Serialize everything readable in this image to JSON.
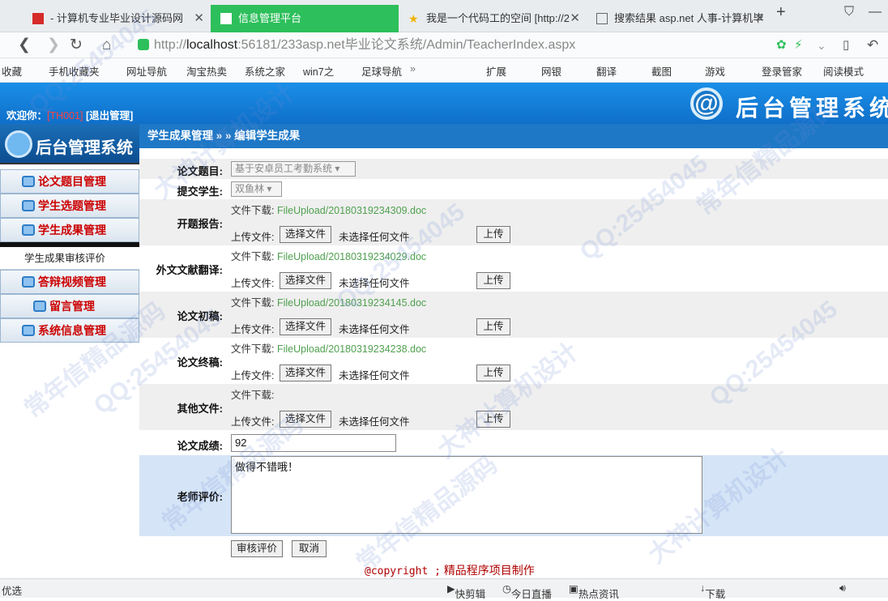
{
  "browser": {
    "tabs": [
      {
        "title": "- 计算机专业毕业设计源码网",
        "active": false
      },
      {
        "title": "信息管理平台",
        "active": true
      },
      {
        "title": "我是一个代码工的空间 [http://2",
        "active": false
      },
      {
        "title": "搜索结果 asp.net 人事-计算机毕",
        "active": false
      }
    ],
    "new_tab": "+",
    "url_prefix": "http://",
    "url_host": "localhost",
    "url_rest": ":56181/233asp.net毕业论文系统/Admin/TeacherIndex.aspx",
    "bookmarks": [
      "收藏",
      "手机收藏夹",
      "网址导航",
      "淘宝热卖",
      "系统之家",
      "win7之",
      "足球导航",
      "»"
    ],
    "bookmarks_right": [
      "扩展",
      "网银",
      "翻译",
      "截图",
      "游戏",
      "登录管家",
      "阅读模式"
    ]
  },
  "header": {
    "welcome_label": "欢迎你：",
    "user": "[TH001]",
    "logout": "[退出管理]",
    "logo_text": "后台管理系统",
    "logo_symbol": "@"
  },
  "sidebar": {
    "title": "后台管理系统",
    "items": [
      {
        "label": "论文题目管理"
      },
      {
        "label": "学生选题管理"
      },
      {
        "label": "学生成果管理"
      }
    ],
    "sub_item": "学生成果审核评价",
    "items2": [
      {
        "label": "答辩视频管理"
      },
      {
        "label": "留言管理"
      },
      {
        "label": "系统信息管理"
      }
    ]
  },
  "breadcrumb": "学生成果管理 » » 编辑学生成果",
  "form": {
    "topic_label": "论文题目:",
    "topic_value": "基于安卓员工考勤系统",
    "student_label": "提交学生:",
    "student_value": "双鱼林",
    "download_label": "文件下载:",
    "upload_label": "上传文件:",
    "choose_btn": "选择文件",
    "no_file": "未选择任何文件",
    "upload_btn": "上传",
    "files": [
      {
        "label": "开题报告:",
        "link": "FileUpload/20180319234309.doc"
      },
      {
        "label": "外文文献翻译:",
        "link": "FileUpload/20180319234029.doc"
      },
      {
        "label": "论文初稿:",
        "link": "FileUpload/20180319234145.doc"
      },
      {
        "label": "论文终稿:",
        "link": "FileUpload/20180319234238.doc"
      },
      {
        "label": "其他文件:",
        "link": ""
      }
    ],
    "score_label": "论文成绩:",
    "score_value": "92",
    "comment_label": "老师评价:",
    "comment_value": "做得不错哦！",
    "submit_btn": "审核评价",
    "cancel_btn": "取消"
  },
  "footer": {
    "copyright": "@copyright ;",
    "text": "精品程序项目制作"
  },
  "statusbar": {
    "left": "优选",
    "items": [
      "快剪辑",
      "今日直播",
      "热点资讯",
      "下载"
    ]
  },
  "watermarks": [
    "QQ:25454045",
    "大神计算机设计",
    "常年信精品源码",
    "QQ:25454045",
    "常年信精品源码",
    "QQ:25454045",
    "大神计算机设计",
    "常年信精品源码",
    "QQ:25454045",
    "大神计算机设计",
    "QQ:25454045",
    "常年信精品源码"
  ]
}
